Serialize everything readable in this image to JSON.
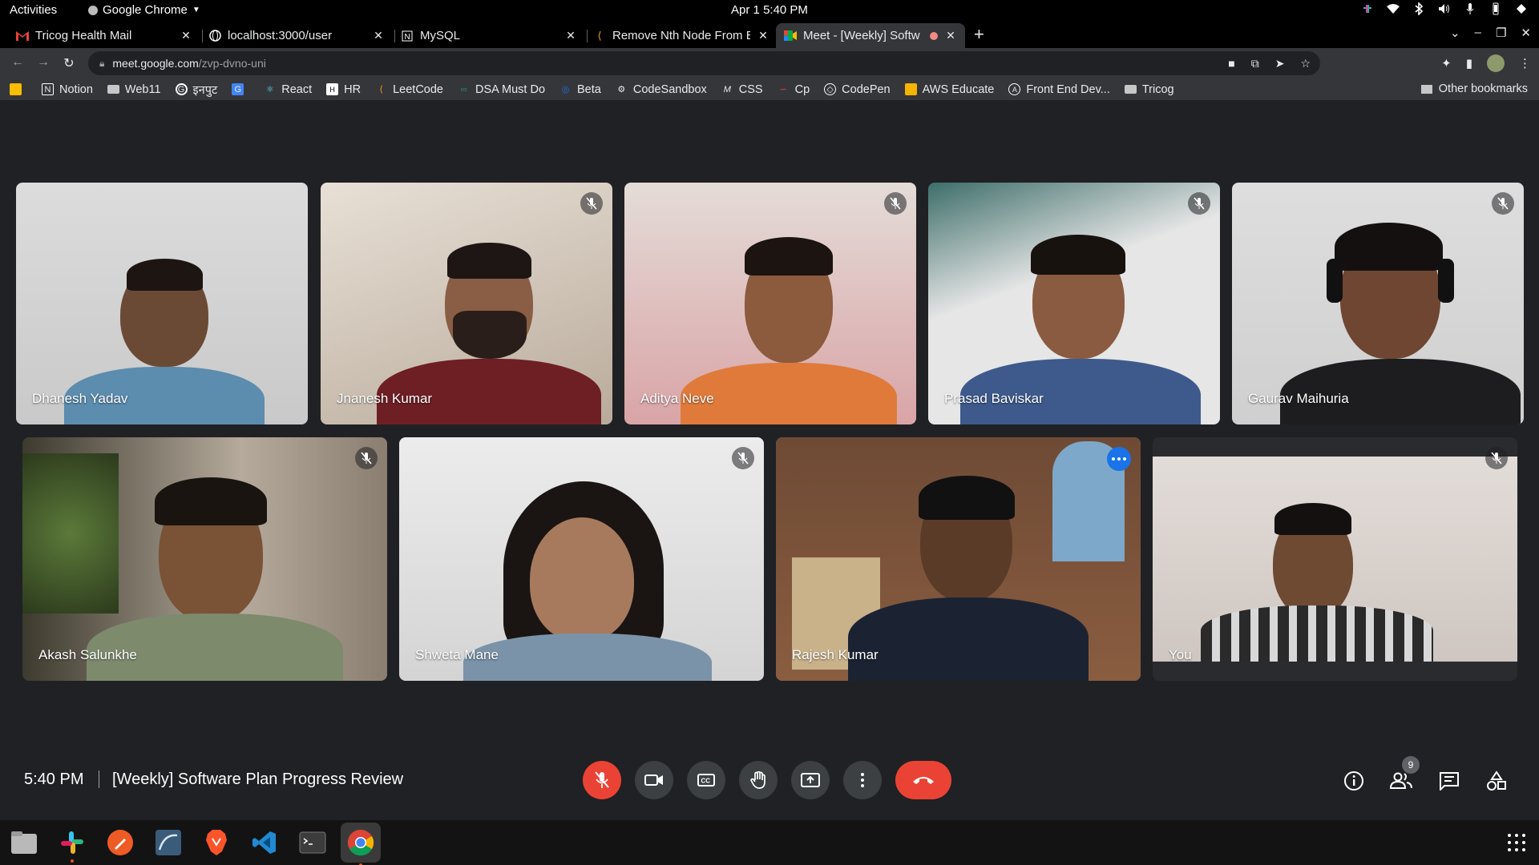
{
  "topbar": {
    "activities": "Activities",
    "app_name": "Google Chrome",
    "clock": "Apr 1  5:40 PM"
  },
  "tabs": [
    {
      "title": "Tricog Health Mail",
      "icon": "gmail-icon"
    },
    {
      "title": "localhost:3000/user",
      "icon": "globe-icon"
    },
    {
      "title": "MySQL",
      "icon": "notion-icon"
    },
    {
      "title": "Remove Nth Node From E",
      "icon": "leetcode-icon"
    },
    {
      "title": "Meet - [Weekly] Softw",
      "icon": "meet-icon",
      "active": true
    }
  ],
  "omnibox": {
    "host": "meet.google.com",
    "path": "/zvp-dvno-uni"
  },
  "bookmarks": [
    {
      "label": "",
      "icon": "keep-icon"
    },
    {
      "label": "Notion",
      "icon": "notion-icon"
    },
    {
      "label": "Web11",
      "icon": "folder-icon"
    },
    {
      "label": "इनपुट",
      "icon": "google-icon"
    },
    {
      "label": "",
      "icon": "translate-icon"
    },
    {
      "label": "React",
      "icon": "react-icon"
    },
    {
      "label": "HR",
      "icon": "hackerrank-icon"
    },
    {
      "label": "LeetCode",
      "icon": "leetcode-icon"
    },
    {
      "label": "DSA Must Do",
      "icon": "gfg-icon"
    },
    {
      "label": "Beta",
      "icon": "beta-icon"
    },
    {
      "label": "CodeSandbox",
      "icon": "codesandbox-icon"
    },
    {
      "label": "CSS",
      "icon": "css-icon"
    },
    {
      "label": "Cp",
      "icon": "cp-icon"
    },
    {
      "label": "CodePen",
      "icon": "codepen-icon"
    },
    {
      "label": "AWS Educate",
      "icon": "aws-icon"
    },
    {
      "label": "Front End Dev...",
      "icon": "frontend-icon"
    },
    {
      "label": "Tricog",
      "icon": "folder-icon"
    }
  ],
  "other_bookmarks": "Other bookmarks",
  "participants": [
    {
      "name": "Dhanesh Yadav",
      "muted": false
    },
    {
      "name": "Jnanesh Kumar",
      "muted": true
    },
    {
      "name": "Aditya Neve",
      "muted": true
    },
    {
      "name": "Prasad Baviskar",
      "muted": true
    },
    {
      "name": "Gaurav Maihuria",
      "muted": true
    },
    {
      "name": "Akash Salunkhe",
      "muted": true
    },
    {
      "name": "Shweta Mane",
      "muted": true
    },
    {
      "name": "Rajesh Kumar",
      "muted": false,
      "speaking": true
    },
    {
      "name": "You",
      "muted": true
    }
  ],
  "meeting": {
    "time": "5:40 PM",
    "title": "[Weekly] Software Plan Progress Review",
    "participant_count": "9"
  },
  "colors": {
    "background": "#202124",
    "end_call": "#ea4335",
    "control": "#3c4043",
    "speaking_outline": "#8ab4f8",
    "more_button": "#1a73e8"
  }
}
